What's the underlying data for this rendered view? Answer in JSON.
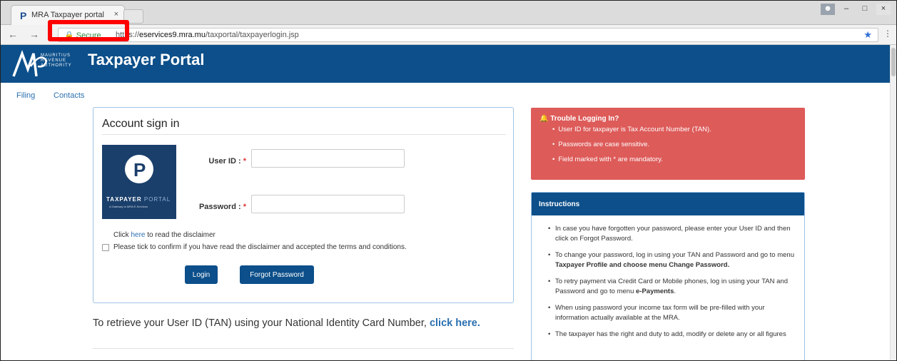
{
  "browser": {
    "tab_title": "MRA Taxpayer portal",
    "tab_close": "×",
    "secure_label": "Secure",
    "url_prefix": "https://",
    "url_host": "eservices9.mra.mu",
    "url_path": "/taxportal/taxpayerlogin.jsp",
    "back": "←",
    "forward": "→",
    "reload": "C",
    "star": "★",
    "menu": "⋮",
    "window_min": "–",
    "window_max": "□",
    "window_close": "×"
  },
  "header": {
    "org_line1": "MAURITIUS",
    "org_line2": "REVENUE",
    "org_line3": "AUTHORITY",
    "title": "Taxpayer Portal"
  },
  "nav": {
    "items": [
      {
        "label": "Filing"
      },
      {
        "label": "Contacts"
      }
    ]
  },
  "signin": {
    "heading": "Account sign in",
    "logo_word1": "TAXPAYER",
    "logo_word2": "PORTAL",
    "logo_tagline": "A Gateway to MRA E-Services",
    "user_label": "User ID :",
    "password_label": "Password :",
    "required_mark": "*",
    "disclaimer_prefix": "Click",
    "disclaimer_link": "here",
    "disclaimer_suffix": "to read the disclaimer",
    "checkbox_label": "Please tick to confirm if you have read the disclaimer and accepted the terms and conditions.",
    "login_button": "Login",
    "forgot_button": "Forgot Password"
  },
  "retrieve": {
    "text": "To retrieve your User ID (TAN) using your National Identity Card Number,",
    "link": "click here."
  },
  "trouble": {
    "heading": "Trouble Logging In?",
    "items": [
      "User ID for taxpayer is Tax Account Number (TAN).",
      "Passwords are case sensitive.",
      "Field marked with * are mandatory."
    ]
  },
  "instructions": {
    "heading": "Instructions",
    "i1": "In case you have forgotten your password, please enter your User ID and then click on Forgot Password.",
    "i2a": "To change your password, log in using your TAN and Password and go to menu",
    "i2b": "Taxpayer Profile and choose menu Change Password.",
    "i3a": "To retry payment via Credit Card or Mobile phones, log in using your TAN and Password and go to menu",
    "i3b": "e-Payments",
    "i4": "When using password your income tax form will be pre-filled with your information actually available at the MRA.",
    "i5": "The taxpayer has the right and duty to add, modify or delete any or all figures"
  }
}
